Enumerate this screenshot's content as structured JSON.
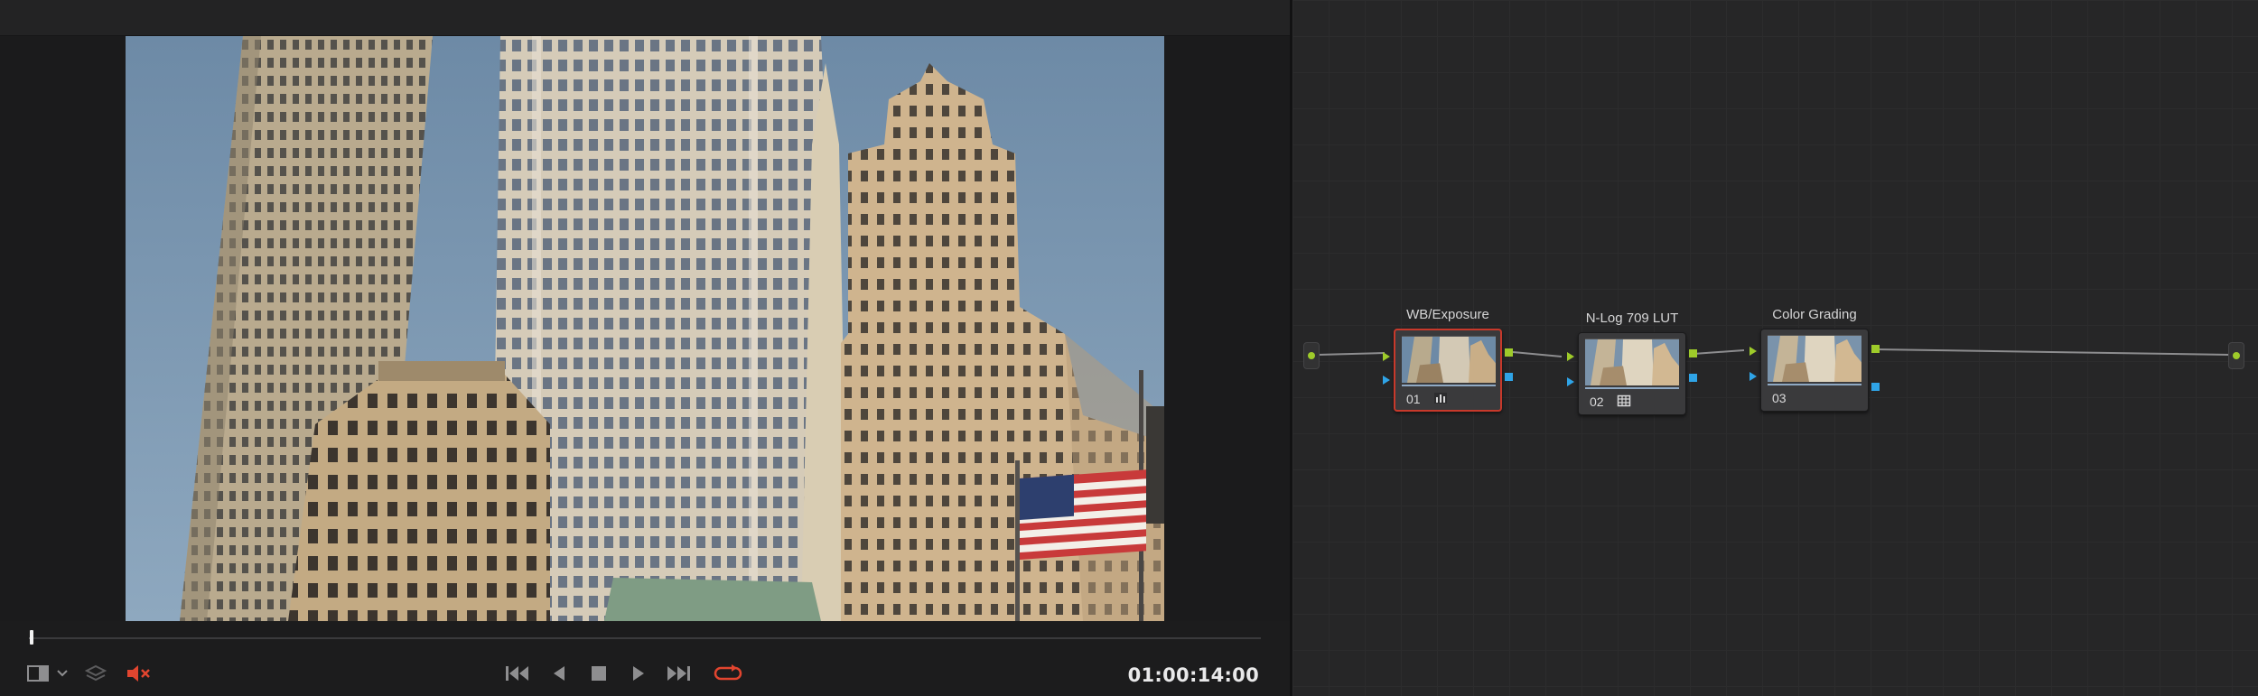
{
  "viewer": {
    "timecode": "01:00:14:00",
    "playhead_fraction": 0.001,
    "audio_muted": true,
    "loop_enabled": true,
    "icons": {
      "layout": "viewer-layout-icon",
      "layout_menu": "chevron-down-icon",
      "layers": "layers-icon",
      "mute": "speaker-muted-icon",
      "first_frame": "jump-to-first-frame-icon",
      "reverse": "play-reverse-icon",
      "stop": "stop-icon",
      "play": "play-icon",
      "last_frame": "jump-to-last-frame-icon",
      "loop": "loop-icon"
    },
    "colors": {
      "accent_red": "#e2452f",
      "timecode": "#e9e9ea"
    }
  },
  "node_graph": {
    "nodes": [
      {
        "label": "WB/Exposure",
        "number": "01",
        "badge": "bars-icon",
        "selected": true
      },
      {
        "label": "N-Log 709 LUT",
        "number": "02",
        "badge": "lut-grid-icon",
        "selected": false
      },
      {
        "label": "Color Grading",
        "number": "03",
        "badge": "",
        "selected": false
      }
    ],
    "colors": {
      "rgb_link": "#9ecb2a",
      "alpha_link": "#2fa4e7",
      "selected_outline": "#c8392b"
    }
  }
}
